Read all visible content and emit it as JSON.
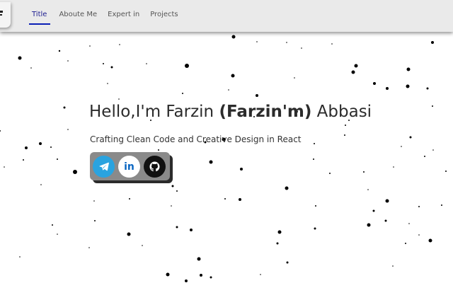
{
  "nav": {
    "items": [
      {
        "label": "Title",
        "active": true
      },
      {
        "label": "Aboute Me",
        "active": false
      },
      {
        "label": "Expert in",
        "active": false
      },
      {
        "label": "Projects",
        "active": false
      }
    ],
    "active_color": "#0a1fb5"
  },
  "hero": {
    "greeting": "Hello,I'm Farzin ",
    "nickname": "(Farzin'm)",
    "surname": " Abbasi",
    "subtitle": "Crafting Clean Code and Creative Design in React"
  },
  "social": [
    {
      "name": "telegram",
      "icon": "telegram-icon",
      "color": "#2aa3df"
    },
    {
      "name": "linkedin",
      "icon": "linkedin-icon",
      "text": "in",
      "color": "#0a66c2"
    },
    {
      "name": "github",
      "icon": "github-icon",
      "color": "#111111"
    }
  ]
}
